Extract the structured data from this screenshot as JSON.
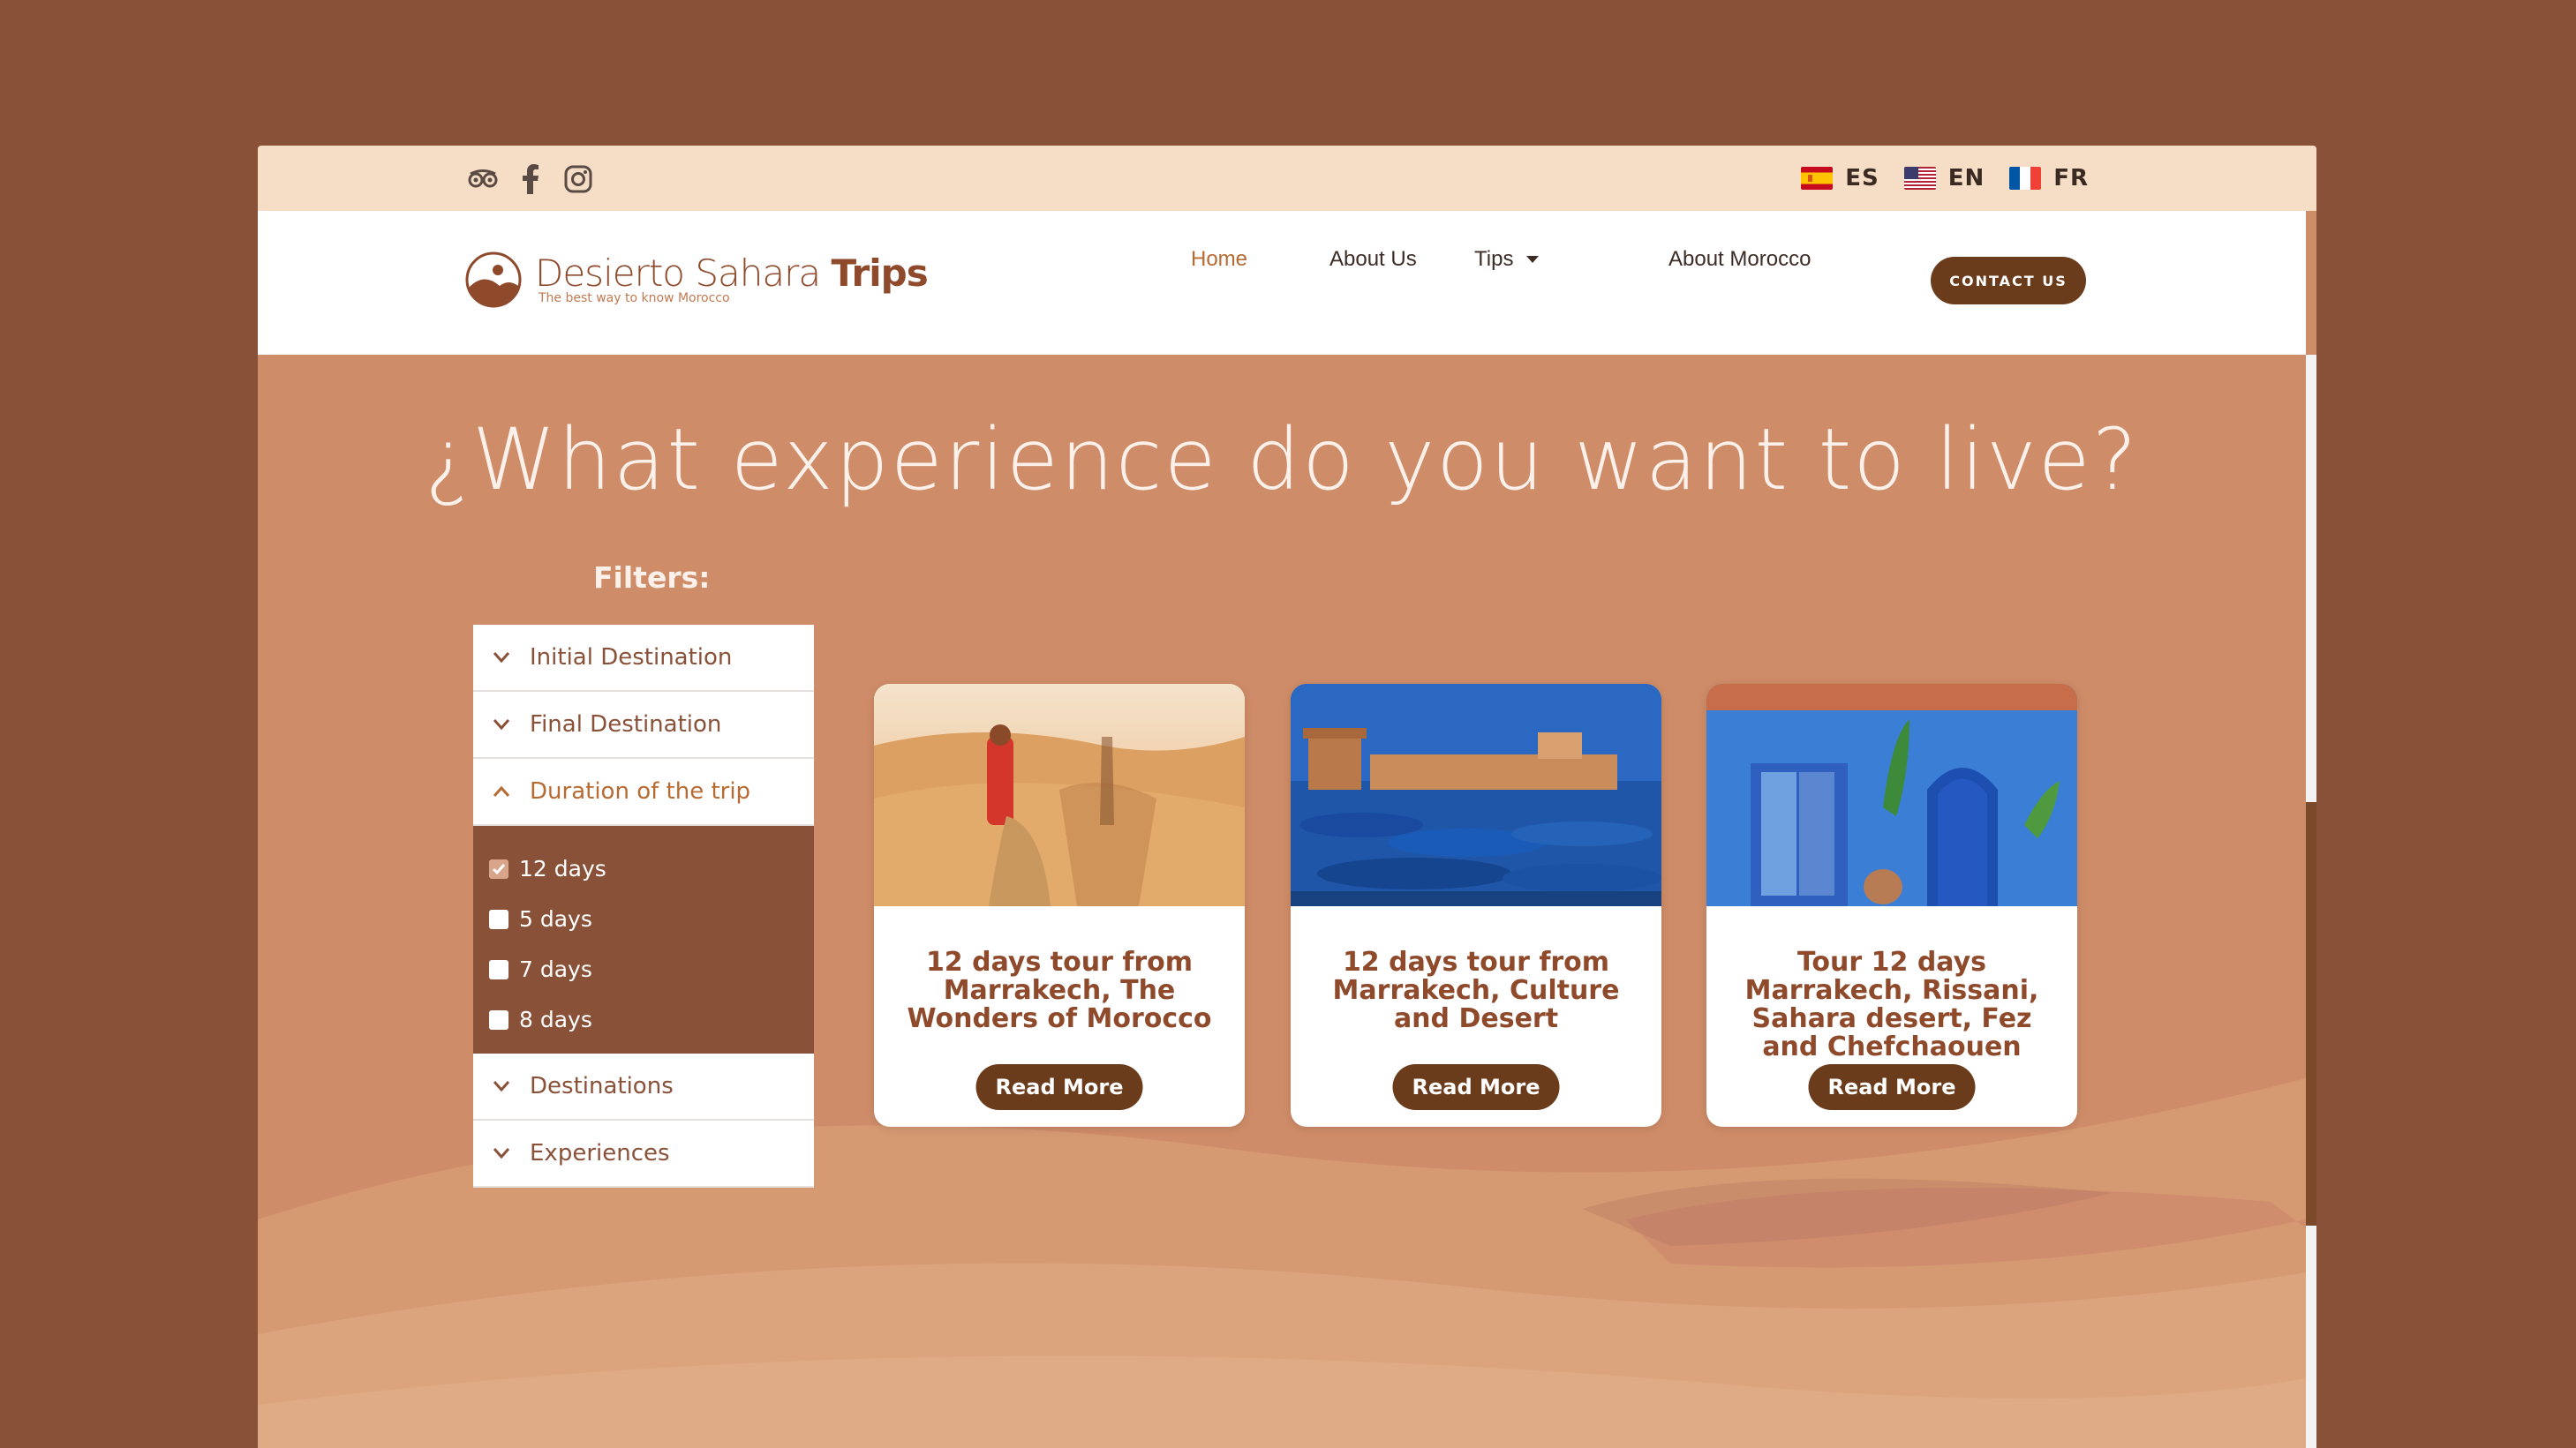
{
  "header": {
    "social_icons": [
      "tripadvisor-icon",
      "facebook-icon",
      "instagram-icon"
    ],
    "languages": [
      {
        "code": "ES",
        "flag": "spain-flag-icon"
      },
      {
        "code": "EN",
        "flag": "usa-flag-icon"
      },
      {
        "code": "FR",
        "flag": "france-flag-icon"
      }
    ]
  },
  "nav": {
    "logo_main": "Desierto Sahara",
    "logo_trips": "Trips",
    "logo_tagline": "The best way to know Morocco",
    "items": [
      {
        "label": "Home",
        "active": true
      },
      {
        "label": "About Us"
      },
      {
        "label": "Tips",
        "has_dropdown": true
      },
      {
        "label": "About Morocco"
      }
    ],
    "contact_label": "CONTACT US"
  },
  "main": {
    "headline": "¿What experience do you want to live?",
    "filters_title": "Filters:",
    "filters": {
      "initial_destination": "Initial Destination",
      "final_destination": "Final Destination",
      "duration": "Duration of the trip",
      "duration_options": [
        {
          "label": "12 days",
          "checked": true
        },
        {
          "label": "5 days",
          "checked": false
        },
        {
          "label": "7 days",
          "checked": false
        },
        {
          "label": "8 days",
          "checked": false
        }
      ],
      "destinations": "Destinations",
      "experiences": "Experiences"
    },
    "cards": [
      {
        "title": "12 days tour from Marrakech, The Wonders of Morocco",
        "button": "Read More",
        "image": "desert-camel-image"
      },
      {
        "title": "12 days tour from Marrakech, Culture and Desert",
        "button": "Read More",
        "image": "essaouira-boats-image"
      },
      {
        "title": "Tour 12 days Marrakech, Rissani, Sahara desert, Fez and Chefchaouen",
        "button": "Read More",
        "image": "chefchaouen-blue-image"
      }
    ]
  },
  "colors": {
    "page_bg": "#8a5139",
    "section_bg": "#cf8c68",
    "topbar_bg": "#f6ddc6",
    "accent_dark": "#6b3c1c",
    "accent_text": "#8e4a2b"
  }
}
